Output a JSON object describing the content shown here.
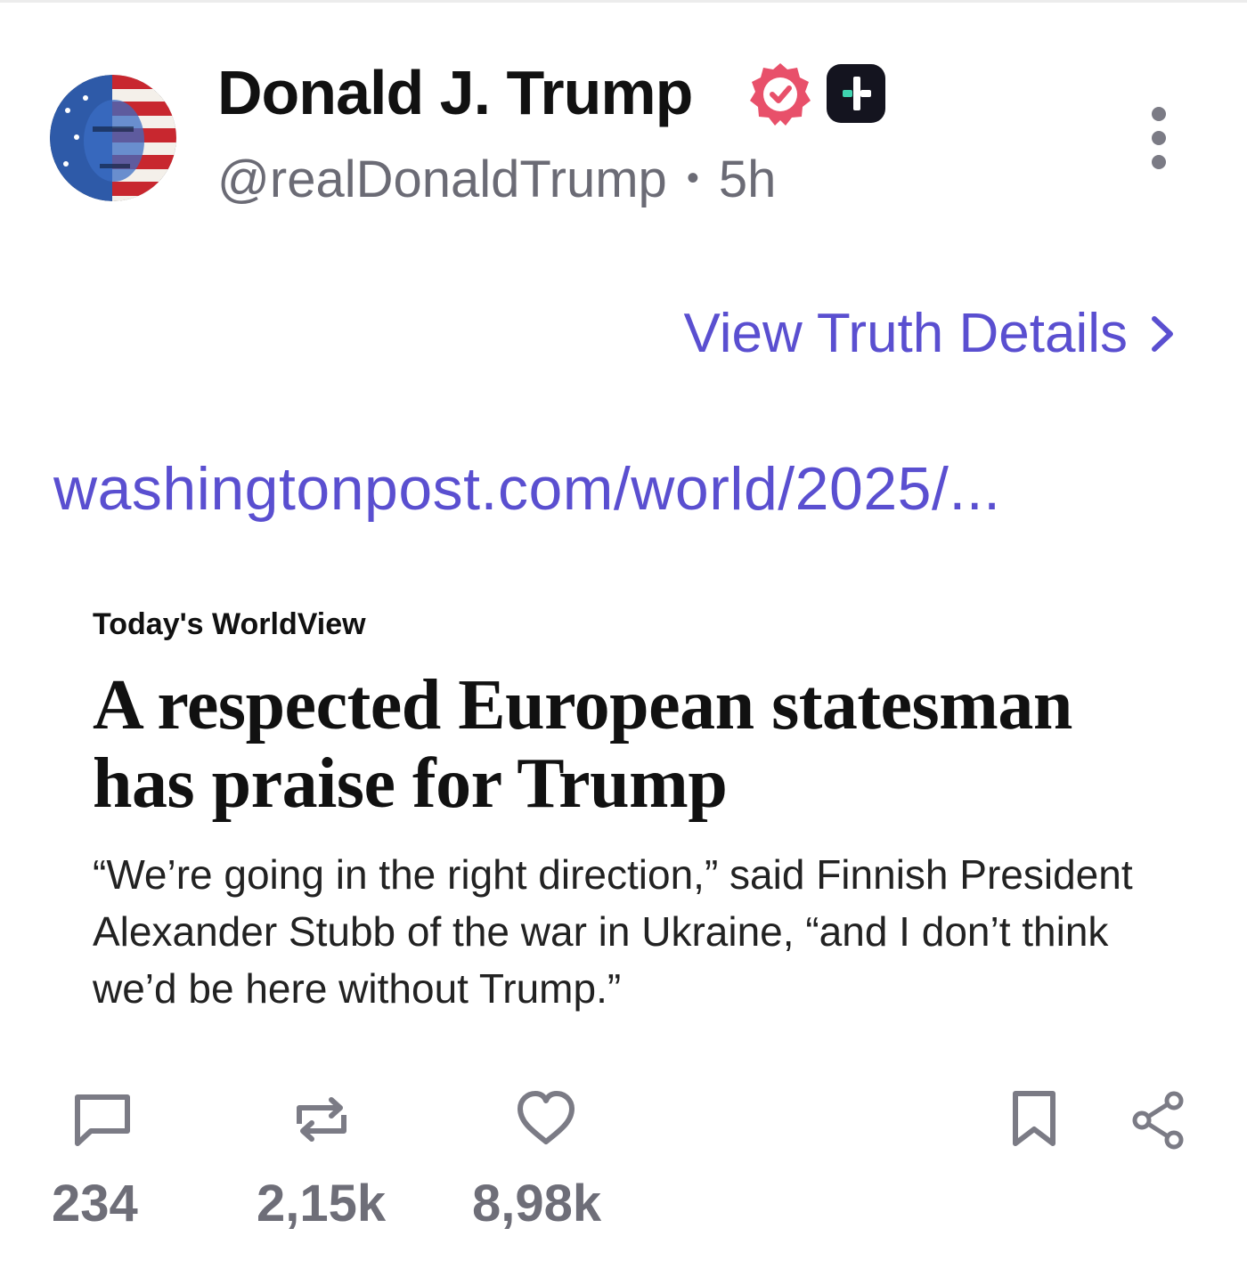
{
  "author": {
    "display_name": "Donald J. Trump",
    "handle": "@realDonaldTrump",
    "separator": "•",
    "time_ago": "5h"
  },
  "post": {
    "details_link_label": "View Truth Details",
    "url_text": "washingtonpost.com/world/2025/..."
  },
  "link_card": {
    "kicker": "Today's WorldView",
    "headline": "A respected European statesman has praise for Trump",
    "dek": "“We’re going in the right direction,” said Finnish President Alexander Stubb of the war in Ukraine, “and I don’t think we’d be here without Trump.”"
  },
  "actions": {
    "replies_count": "234",
    "retruths_count": "2,15k",
    "likes_count": "8,98k"
  },
  "colors": {
    "link": "#5a4fd0",
    "verified": "#e8506a",
    "muted": "#6e6e78"
  }
}
